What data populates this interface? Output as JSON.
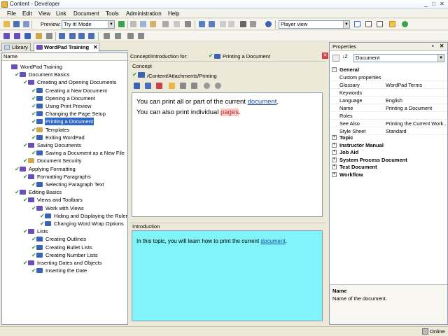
{
  "window": {
    "title": "Content - Developer"
  },
  "menu": [
    "File",
    "Edit",
    "View",
    "Link",
    "Document",
    "Tools",
    "Administration",
    "Help"
  ],
  "toolbar": {
    "preview_label": "Preview:",
    "preview_mode": "Try It! Mode",
    "player_view": "Player view"
  },
  "tabs": {
    "library": "Library",
    "wordpad": "WordPad Training"
  },
  "tree": {
    "header": "Name",
    "nodes": [
      {
        "label": "WordPad Training",
        "level": 0,
        "kind": "module",
        "check": false
      },
      {
        "label": "Document Basics",
        "level": 1,
        "kind": "module",
        "check": true
      },
      {
        "label": "Creating and Opening Documents",
        "level": 2,
        "kind": "section",
        "check": true
      },
      {
        "label": "Creating a New Document",
        "level": 3,
        "kind": "topic",
        "check": true
      },
      {
        "label": "Opening a Document",
        "level": 3,
        "kind": "topic",
        "check": true
      },
      {
        "label": "Using Print Preview",
        "level": 3,
        "kind": "topic",
        "check": true
      },
      {
        "label": "Changing the Page Setup",
        "level": 3,
        "kind": "topic",
        "check": true
      },
      {
        "label": "Printing a Document",
        "level": 3,
        "kind": "topic",
        "check": true,
        "selected": true
      },
      {
        "label": "Templates",
        "level": 3,
        "kind": "doc",
        "check": true
      },
      {
        "label": "Exiting WordPad",
        "level": 3,
        "kind": "topic",
        "check": true
      },
      {
        "label": "Saving Documents",
        "level": 2,
        "kind": "section",
        "check": true
      },
      {
        "label": "Saving a Document as a New File",
        "level": 3,
        "kind": "topic",
        "check": true
      },
      {
        "label": "Document Security",
        "level": 2,
        "kind": "doc",
        "check": true
      },
      {
        "label": "Applying Formatting",
        "level": 1,
        "kind": "module",
        "check": true
      },
      {
        "label": "Formatting Paragraphs",
        "level": 2,
        "kind": "section",
        "check": true
      },
      {
        "label": "Selecting Paragraph Text",
        "level": 3,
        "kind": "topic",
        "check": true
      },
      {
        "label": "Editing Basics",
        "level": 1,
        "kind": "module",
        "check": true
      },
      {
        "label": "Views and Toolbars",
        "level": 2,
        "kind": "section",
        "check": true
      },
      {
        "label": "Work with Views",
        "level": 3,
        "kind": "section",
        "check": true
      },
      {
        "label": "Hiding and Displaying the Ruler",
        "level": 4,
        "kind": "topic",
        "check": true
      },
      {
        "label": "Changing Word Wrap Options",
        "level": 4,
        "kind": "topic",
        "check": true
      },
      {
        "label": "Lists",
        "level": 2,
        "kind": "section",
        "check": true
      },
      {
        "label": "Creating Outlines",
        "level": 3,
        "kind": "topic",
        "check": true
      },
      {
        "label": "Creating Bullet Lists",
        "level": 3,
        "kind": "topic",
        "check": true
      },
      {
        "label": "Creating Number Lists",
        "level": 3,
        "kind": "topic",
        "check": true
      },
      {
        "label": "Inserting Dates and Objects",
        "level": 2,
        "kind": "section",
        "check": true
      },
      {
        "label": "Inserting the Date",
        "level": 3,
        "kind": "topic",
        "check": true
      }
    ]
  },
  "content": {
    "for_label": "Concept/Introduction for:",
    "for_value": "Printing a Document",
    "concept_label": "Concept",
    "path": "/Content/Attachments/Printing",
    "line1_prefix": "You can print all or part of the current ",
    "line1_link": "document",
    "line1_suffix": ".",
    "line2_prefix": "You can also print individual ",
    "line2_link": "pages",
    "line2_suffix": ".",
    "intro_label": "Introduction",
    "intro_prefix": "In this topic, you will learn how to print the current ",
    "intro_link": "document",
    "intro_suffix": ".",
    "intro_bg": "#80f4f8"
  },
  "properties": {
    "title": "Properties",
    "selected": "Document",
    "general_label": "General",
    "rows": [
      {
        "key": "Custom properties",
        "value": ""
      },
      {
        "key": "Glossary",
        "value": "WordPad Terms"
      },
      {
        "key": "Keywords",
        "value": ""
      },
      {
        "key": "Language",
        "value": "English"
      },
      {
        "key": "Name",
        "value": "Printing a Document"
      },
      {
        "key": "Roles",
        "value": ""
      },
      {
        "key": "See Also",
        "value": "Printing the Current Work..."
      },
      {
        "key": "Style Sheet",
        "value": "Standard"
      }
    ],
    "categories": [
      "Topic",
      "Instructor Manual",
      "Job Aid",
      "System Process Document",
      "Test Document",
      "Workflow"
    ],
    "desc_title": "Name",
    "desc_text": "Name of the document."
  },
  "status": {
    "text": "Online"
  },
  "colors": {
    "accent": "#316ac5",
    "check": "#2c9a2c",
    "book": "#6a4fb8"
  }
}
